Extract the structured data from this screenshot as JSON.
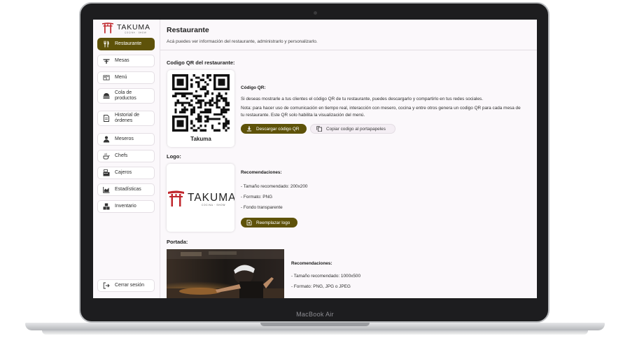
{
  "device": {
    "label": "MacBook Air"
  },
  "brand": {
    "name": "TAKUMA",
    "tagline": "COCINA · SHOW"
  },
  "sidebar": {
    "items": [
      {
        "label": "Restaurante",
        "icon": "fork-knife-icon",
        "active": true
      },
      {
        "label": "Mesas",
        "icon": "table-icon"
      },
      {
        "label": "Menú",
        "icon": "menu-book-icon"
      },
      {
        "label": "Cola de productos",
        "icon": "queue-icon"
      },
      {
        "label": "Historial de órdenes",
        "icon": "document-icon"
      },
      {
        "label": "Meseros",
        "icon": "waiter-icon"
      },
      {
        "label": "Chefs",
        "icon": "chef-icon"
      },
      {
        "label": "Cajeros",
        "icon": "register-icon"
      },
      {
        "label": "Estadísticas",
        "icon": "chart-icon"
      },
      {
        "label": "Inventario",
        "icon": "boxes-icon"
      }
    ],
    "logout": {
      "label": "Cerrar sesión",
      "icon": "logout-icon"
    }
  },
  "header": {
    "title": "Restaurante",
    "subtitle": "Acá puedes ver información del restaurante, administrarlo y personalizarlo."
  },
  "qr_section": {
    "title": "Codigo QR del restaurante:",
    "qr_caption": "Takuma",
    "heading": "Código QR:",
    "description": "Si deseas mostrarle a tus clientes el código QR de tu restaurante, puedes descargarlo y compartirlo en tus redes sociales.",
    "note": "Nota: para hacer uso de comunicación en tiempo real, interacción con mesero, cocina y entre otros genera un codigo QR para cada mesa de tu restaurante. Este QR solo habilita la visualización del menú.",
    "download_label": "Descargar código QR",
    "copy_label": "Copiar codigo al portapapeles"
  },
  "logo_section": {
    "title": "Logo:",
    "heading": "Recomendaciones:",
    "items": [
      "- Tamaño recomendado: 200x200",
      "- Formato: PNG",
      "- Fondo transparente"
    ],
    "replace_label": "Reemplazar logo"
  },
  "cover_section": {
    "title": "Portada:",
    "heading": "Recomendaciones:",
    "items": [
      "- Tamaño recomendado: 1000x500",
      "- Formato: PNG, JPG o JPEG"
    ]
  },
  "colors": {
    "accent": "#5e5209",
    "logo_red": "#c0272d",
    "background": "#fbf8fb"
  }
}
